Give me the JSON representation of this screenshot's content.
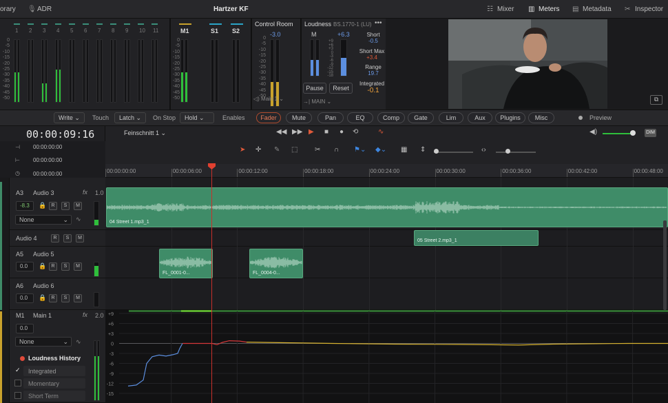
{
  "top_bar": {
    "library_label": "orary",
    "adr_label": "ADR",
    "project_title": "Hartzer KF",
    "mixer_label": "Mixer",
    "meters_label": "Meters",
    "metadata_label": "Metadata",
    "inspector_label": "Inspector"
  },
  "meters": {
    "channels": [
      "1",
      "2",
      "3",
      "4",
      "5",
      "6",
      "7",
      "8",
      "9",
      "10",
      "11"
    ],
    "scale": [
      "0",
      "-5",
      "-10",
      "-15",
      "-20",
      "-25",
      "-30",
      "-35",
      "-40",
      "-45",
      "-50"
    ],
    "main_label": "M1",
    "sub1_label": "S1",
    "sub2_label": "S2"
  },
  "control_room": {
    "title": "Control Room",
    "value": "-3.0",
    "scale": [
      "0",
      "-5",
      "-10",
      "-15",
      "-20",
      "-25",
      "-30",
      "-35",
      "-40",
      "-45",
      "-50"
    ],
    "output": "Main 1"
  },
  "loudness": {
    "title": "Loudness",
    "standard": "BS.1770-1 (LU)",
    "m_label": "M",
    "m_value": "+6.3",
    "scale": [
      "+9",
      "+6",
      "+3",
      "0",
      "-3",
      "-6",
      "-9",
      "-12",
      "-15",
      "-18"
    ],
    "short_label": "Short",
    "short_value": "-0.5",
    "short_max_label": "Short Max",
    "short_max_value": "+3.4",
    "range_label": "Range",
    "range_value": "19.7",
    "integrated_label": "Integrated",
    "integrated_value": "-0.1",
    "pause_label": "Pause",
    "reset_label": "Reset",
    "output": "MAIN"
  },
  "automation": {
    "write_label": "Write",
    "touch_label": "Touch",
    "latch_label": "Latch",
    "on_stop_label": "On Stop",
    "hold_label": "Hold",
    "enables_label": "Enables",
    "buttons": [
      "Fader",
      "Mute",
      "Pan",
      "EQ",
      "Comp",
      "Gate",
      "Lim",
      "Aux",
      "Plugins",
      "Misc"
    ],
    "preview_label": "Preview"
  },
  "timeline": {
    "timecode": "00:00:09:16",
    "timeline_name": "Feinschnitt 1",
    "sub_timecodes": [
      "00:00:00:00",
      "00:00:00:00",
      "00:00:00:00"
    ],
    "ruler": [
      "00:00:00:00",
      "00:00:06:00",
      "00:00:12:00",
      "00:00:18:00",
      "00:00:24:00",
      "00:00:30:00",
      "00:00:36:00",
      "00:00:42:00",
      "00:00:48:00"
    ],
    "dim_label": "DIM",
    "playhead_seconds": 9.6
  },
  "tracks": [
    {
      "id": "A3",
      "name": "Audio 3",
      "volume": "-8.3",
      "assign": "None",
      "fx": "fx",
      "level": "1.0"
    },
    {
      "id": "",
      "name": "Audio 4"
    },
    {
      "id": "A5",
      "name": "Audio 5",
      "volume": "0.0"
    },
    {
      "id": "A6",
      "name": "Audio 6",
      "volume": "0.0"
    },
    {
      "id": "M1",
      "name": "Main 1",
      "volume": "0.0",
      "assign": "None",
      "fx": "fx",
      "level": "2.0"
    }
  ],
  "track_buttons": {
    "r": "R",
    "s": "S",
    "m": "M"
  },
  "clips": [
    {
      "name": "04 Street 1.mp3_1"
    },
    {
      "name": "05 Street 2.mp3_1"
    },
    {
      "name": "FL_0001-0..."
    },
    {
      "name": "FL_0004-0..."
    }
  ],
  "loudness_history": {
    "title": "Loudness History",
    "options": [
      {
        "label": "Integrated",
        "checked": true
      },
      {
        "label": "Momentary",
        "checked": false
      },
      {
        "label": "Short Term",
        "checked": false
      }
    ],
    "scale": [
      "+9",
      "+6",
      "+3",
      "0",
      "-3",
      "-6",
      "-9",
      "-12",
      "-15"
    ]
  },
  "colors": {
    "accent": "#e05a3a",
    "clip": "#3f8c68",
    "meter_green": "#2fbf3b",
    "meter_gold": "#c9a22c",
    "meter_blue": "#5c8fe0"
  }
}
